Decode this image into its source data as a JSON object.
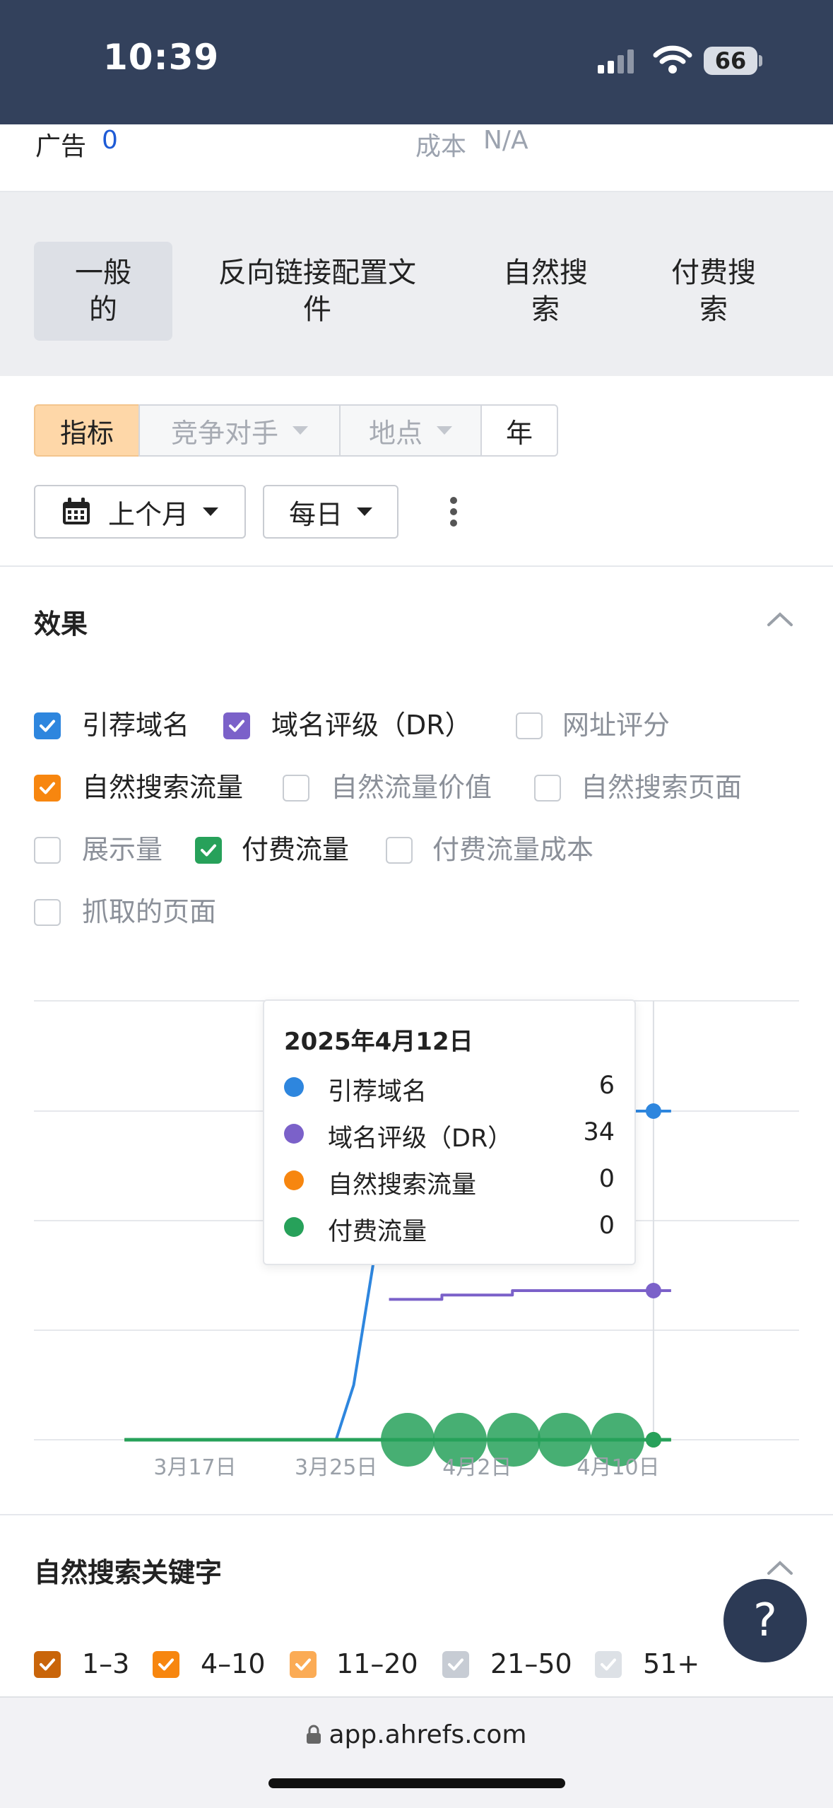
{
  "status_bar": {
    "time": "10:39",
    "battery": "66"
  },
  "summary": {
    "ads_label": "广告",
    "ads_value": "0",
    "cost_label": "成本",
    "cost_value": "N/A"
  },
  "tabs": [
    {
      "line1": "一般",
      "line2": "的"
    },
    {
      "line1": "反向链接配置文",
      "line2": "件"
    },
    {
      "line1": "自然搜",
      "line2": "索"
    },
    {
      "line1": "付费搜",
      "line2": "索"
    }
  ],
  "filters": {
    "segments": [
      "指标",
      "竞争对手",
      "地点",
      "年"
    ],
    "date_range": "上个月",
    "granularity": "每日"
  },
  "performance": {
    "title": "效果",
    "metrics": [
      {
        "label": "引荐域名",
        "checked": true,
        "color": "#2e86de"
      },
      {
        "label": "域名评级（DR）",
        "checked": true,
        "color": "#7b61c9"
      },
      {
        "label": "网址评分",
        "checked": false
      },
      {
        "label": "自然搜索流量",
        "checked": true,
        "color": "#f7860f"
      },
      {
        "label": "自然流量价值",
        "checked": false
      },
      {
        "label": "自然搜索页面",
        "checked": false
      },
      {
        "label": "展示量",
        "checked": false
      },
      {
        "label": "付费流量",
        "checked": true,
        "color": "#27a15a"
      },
      {
        "label": "付费流量成本",
        "checked": false
      },
      {
        "label": "抓取的页面",
        "checked": false
      }
    ]
  },
  "chart_data": {
    "type": "line",
    "x_ticks": [
      "3月17日",
      "3月25日",
      "4月2日",
      "4月10日"
    ],
    "series": [
      {
        "name": "引荐域名",
        "color": "#2e86de",
        "x": [
          "3月13日",
          "3月25日",
          "3月26日",
          "3月27日",
          "3月28日",
          "4月2日",
          "4月3日",
          "4月12日",
          "4月13日"
        ],
        "values": [
          0,
          0,
          1,
          3,
          5,
          5,
          6,
          6,
          6
        ]
      },
      {
        "name": "域名评级（DR）",
        "color": "#7b61c9",
        "x": [
          "3月28日",
          "3月30日",
          "3月31日",
          "4月3日",
          "4月4日",
          "4月12日",
          "4月13日"
        ],
        "values": [
          32,
          32,
          33,
          33,
          34,
          34,
          34
        ]
      },
      {
        "name": "自然搜索流量",
        "color": "#f7860f",
        "x": [
          "3月13日",
          "4月13日"
        ],
        "values": [
          0,
          0
        ]
      },
      {
        "name": "付费流量",
        "color": "#27a15a",
        "x": [
          "3月13日",
          "4月13日"
        ],
        "values": [
          0,
          0
        ]
      }
    ],
    "tooltip": {
      "date": "2025年4月12日",
      "rows": [
        {
          "name": "引荐域名",
          "value": "6",
          "color": "#2e86de"
        },
        {
          "name": "域名评级（DR）",
          "value": "34",
          "color": "#7b61c9"
        },
        {
          "name": "自然搜索流量",
          "value": "0",
          "color": "#f7860f"
        },
        {
          "name": "付费流量",
          "value": "0",
          "color": "#27a15a"
        }
      ]
    },
    "grid": true
  },
  "organic_keywords": {
    "title": "自然搜索关键字",
    "ranges": [
      {
        "label": "1–3",
        "checked": true,
        "color": "#c9650a"
      },
      {
        "label": "4–10",
        "checked": true,
        "color": "#f7860f"
      },
      {
        "label": "11–20",
        "checked": true,
        "color": "#fbab55"
      },
      {
        "label": "21–50",
        "checked": true,
        "color": "#c7ccd4"
      },
      {
        "label": "51+",
        "checked": true,
        "color": "#dde1e6"
      }
    ]
  },
  "help": {
    "label": "?"
  },
  "browser": {
    "url": "app.ahrefs.com"
  }
}
